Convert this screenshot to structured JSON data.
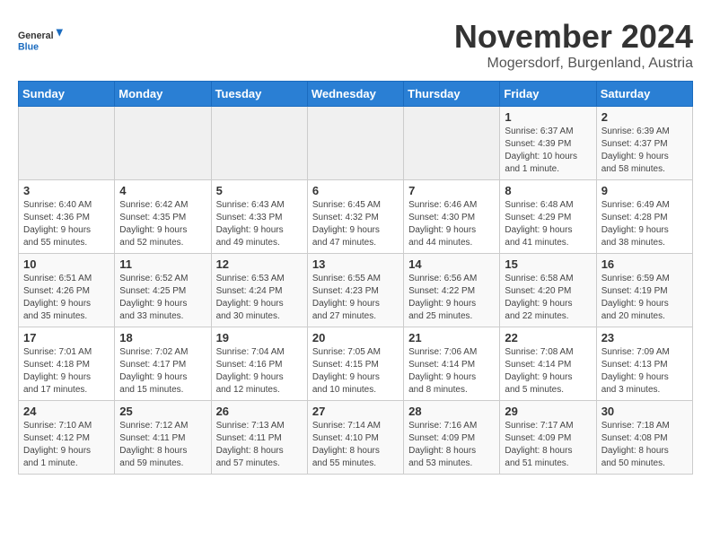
{
  "header": {
    "logo_general": "General",
    "logo_blue": "Blue",
    "month_title": "November 2024",
    "location": "Mogersdorf, Burgenland, Austria"
  },
  "days_of_week": [
    "Sunday",
    "Monday",
    "Tuesday",
    "Wednesday",
    "Thursday",
    "Friday",
    "Saturday"
  ],
  "weeks": [
    [
      {
        "day": "",
        "info": ""
      },
      {
        "day": "",
        "info": ""
      },
      {
        "day": "",
        "info": ""
      },
      {
        "day": "",
        "info": ""
      },
      {
        "day": "",
        "info": ""
      },
      {
        "day": "1",
        "info": "Sunrise: 6:37 AM\nSunset: 4:39 PM\nDaylight: 10 hours\nand 1 minute."
      },
      {
        "day": "2",
        "info": "Sunrise: 6:39 AM\nSunset: 4:37 PM\nDaylight: 9 hours\nand 58 minutes."
      }
    ],
    [
      {
        "day": "3",
        "info": "Sunrise: 6:40 AM\nSunset: 4:36 PM\nDaylight: 9 hours\nand 55 minutes."
      },
      {
        "day": "4",
        "info": "Sunrise: 6:42 AM\nSunset: 4:35 PM\nDaylight: 9 hours\nand 52 minutes."
      },
      {
        "day": "5",
        "info": "Sunrise: 6:43 AM\nSunset: 4:33 PM\nDaylight: 9 hours\nand 49 minutes."
      },
      {
        "day": "6",
        "info": "Sunrise: 6:45 AM\nSunset: 4:32 PM\nDaylight: 9 hours\nand 47 minutes."
      },
      {
        "day": "7",
        "info": "Sunrise: 6:46 AM\nSunset: 4:30 PM\nDaylight: 9 hours\nand 44 minutes."
      },
      {
        "day": "8",
        "info": "Sunrise: 6:48 AM\nSunset: 4:29 PM\nDaylight: 9 hours\nand 41 minutes."
      },
      {
        "day": "9",
        "info": "Sunrise: 6:49 AM\nSunset: 4:28 PM\nDaylight: 9 hours\nand 38 minutes."
      }
    ],
    [
      {
        "day": "10",
        "info": "Sunrise: 6:51 AM\nSunset: 4:26 PM\nDaylight: 9 hours\nand 35 minutes."
      },
      {
        "day": "11",
        "info": "Sunrise: 6:52 AM\nSunset: 4:25 PM\nDaylight: 9 hours\nand 33 minutes."
      },
      {
        "day": "12",
        "info": "Sunrise: 6:53 AM\nSunset: 4:24 PM\nDaylight: 9 hours\nand 30 minutes."
      },
      {
        "day": "13",
        "info": "Sunrise: 6:55 AM\nSunset: 4:23 PM\nDaylight: 9 hours\nand 27 minutes."
      },
      {
        "day": "14",
        "info": "Sunrise: 6:56 AM\nSunset: 4:22 PM\nDaylight: 9 hours\nand 25 minutes."
      },
      {
        "day": "15",
        "info": "Sunrise: 6:58 AM\nSunset: 4:20 PM\nDaylight: 9 hours\nand 22 minutes."
      },
      {
        "day": "16",
        "info": "Sunrise: 6:59 AM\nSunset: 4:19 PM\nDaylight: 9 hours\nand 20 minutes."
      }
    ],
    [
      {
        "day": "17",
        "info": "Sunrise: 7:01 AM\nSunset: 4:18 PM\nDaylight: 9 hours\nand 17 minutes."
      },
      {
        "day": "18",
        "info": "Sunrise: 7:02 AM\nSunset: 4:17 PM\nDaylight: 9 hours\nand 15 minutes."
      },
      {
        "day": "19",
        "info": "Sunrise: 7:04 AM\nSunset: 4:16 PM\nDaylight: 9 hours\nand 12 minutes."
      },
      {
        "day": "20",
        "info": "Sunrise: 7:05 AM\nSunset: 4:15 PM\nDaylight: 9 hours\nand 10 minutes."
      },
      {
        "day": "21",
        "info": "Sunrise: 7:06 AM\nSunset: 4:14 PM\nDaylight: 9 hours\nand 8 minutes."
      },
      {
        "day": "22",
        "info": "Sunrise: 7:08 AM\nSunset: 4:14 PM\nDaylight: 9 hours\nand 5 minutes."
      },
      {
        "day": "23",
        "info": "Sunrise: 7:09 AM\nSunset: 4:13 PM\nDaylight: 9 hours\nand 3 minutes."
      }
    ],
    [
      {
        "day": "24",
        "info": "Sunrise: 7:10 AM\nSunset: 4:12 PM\nDaylight: 9 hours\nand 1 minute."
      },
      {
        "day": "25",
        "info": "Sunrise: 7:12 AM\nSunset: 4:11 PM\nDaylight: 8 hours\nand 59 minutes."
      },
      {
        "day": "26",
        "info": "Sunrise: 7:13 AM\nSunset: 4:11 PM\nDaylight: 8 hours\nand 57 minutes."
      },
      {
        "day": "27",
        "info": "Sunrise: 7:14 AM\nSunset: 4:10 PM\nDaylight: 8 hours\nand 55 minutes."
      },
      {
        "day": "28",
        "info": "Sunrise: 7:16 AM\nSunset: 4:09 PM\nDaylight: 8 hours\nand 53 minutes."
      },
      {
        "day": "29",
        "info": "Sunrise: 7:17 AM\nSunset: 4:09 PM\nDaylight: 8 hours\nand 51 minutes."
      },
      {
        "day": "30",
        "info": "Sunrise: 7:18 AM\nSunset: 4:08 PM\nDaylight: 8 hours\nand 50 minutes."
      }
    ]
  ]
}
